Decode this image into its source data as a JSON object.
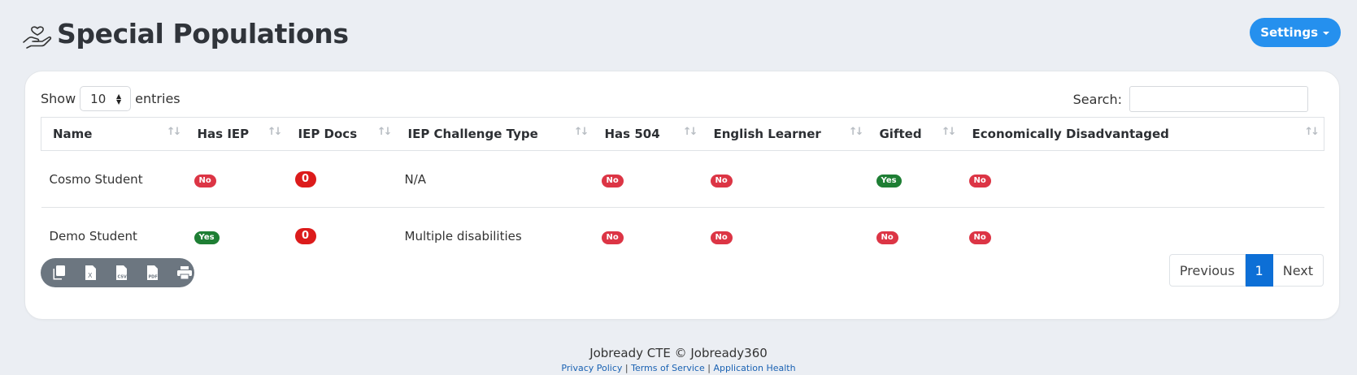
{
  "header": {
    "title": "Special Populations",
    "icon": "hand-heart-icon"
  },
  "settings": {
    "label": "Settings"
  },
  "length": {
    "show_label": "Show",
    "value": "10",
    "entries_label": "entries"
  },
  "search": {
    "label": "Search:",
    "value": "",
    "placeholder": ""
  },
  "table": {
    "columns": [
      "Name",
      "Has IEP",
      "IEP Docs",
      "IEP Challenge Type",
      "Has 504",
      "English Learner",
      "Gifted",
      "Economically Disadvantaged"
    ],
    "rows": [
      {
        "name": "Cosmo Student",
        "has_iep": "No",
        "iep_docs": "0",
        "iep_challenge": "N/A",
        "has_504": "No",
        "english_learner": "No",
        "gifted": "Yes",
        "econ_disadvantaged": "No"
      },
      {
        "name": "Demo Student",
        "has_iep": "Yes",
        "iep_docs": "0",
        "iep_challenge": "Multiple disabilities",
        "has_504": "No",
        "english_learner": "No",
        "gifted": "No",
        "econ_disadvantaged": "No"
      }
    ]
  },
  "export": {
    "buttons": [
      "copy-icon",
      "excel-icon",
      "csv-icon",
      "pdf-icon",
      "print-icon"
    ]
  },
  "pagination": {
    "previous": "Previous",
    "current": "1",
    "next": "Next"
  },
  "footer": {
    "brand": "Jobready CTE © Jobready360",
    "links": [
      "Privacy Policy",
      "Terms of Service",
      "Application Health"
    ],
    "separator": "|"
  },
  "colors": {
    "accent": "#2590ee",
    "no": "#dc3545",
    "yes": "#1e7e34",
    "active_page": "#0d6fd6"
  }
}
